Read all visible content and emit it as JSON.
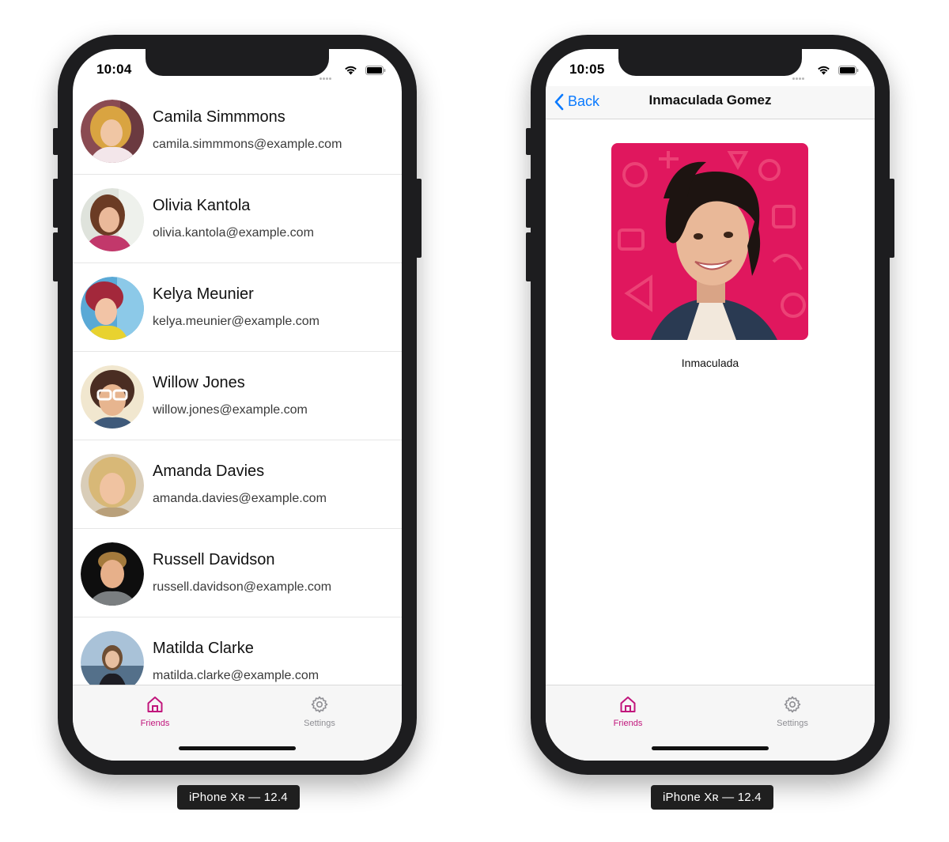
{
  "colors": {
    "accent": "#c1167c",
    "tab_inactive": "#8e8e93",
    "ios_blue": "#0a7aff"
  },
  "left_phone": {
    "status_time": "10:04",
    "friends": [
      {
        "name": "Camila Simmmons",
        "email": "camila.simmmons@example.com"
      },
      {
        "name": "Olivia Kantola",
        "email": "olivia.kantola@example.com"
      },
      {
        "name": "Kelya Meunier",
        "email": "kelya.meunier@example.com"
      },
      {
        "name": "Willow Jones",
        "email": "willow.jones@example.com"
      },
      {
        "name": "Amanda Davies",
        "email": "amanda.davies@example.com"
      },
      {
        "name": "Russell Davidson",
        "email": "russell.davidson@example.com"
      },
      {
        "name": "Matilda Clarke",
        "email": "matilda.clarke@example.com"
      }
    ],
    "tabs": [
      {
        "label": "Friends",
        "icon": "home-icon",
        "active": true
      },
      {
        "label": "Settings",
        "icon": "gear-icon",
        "active": false
      }
    ],
    "device_label": "iPhone Xʀ — 12.4"
  },
  "right_phone": {
    "status_time": "10:05",
    "nav": {
      "back_label": "Back",
      "title": "Inmaculada Gomez"
    },
    "photo_caption": "Inmaculada",
    "tabs": [
      {
        "label": "Friends",
        "icon": "home-icon",
        "active": true
      },
      {
        "label": "Settings",
        "icon": "gear-icon",
        "active": false
      }
    ],
    "device_label": "iPhone Xʀ — 12.4"
  }
}
